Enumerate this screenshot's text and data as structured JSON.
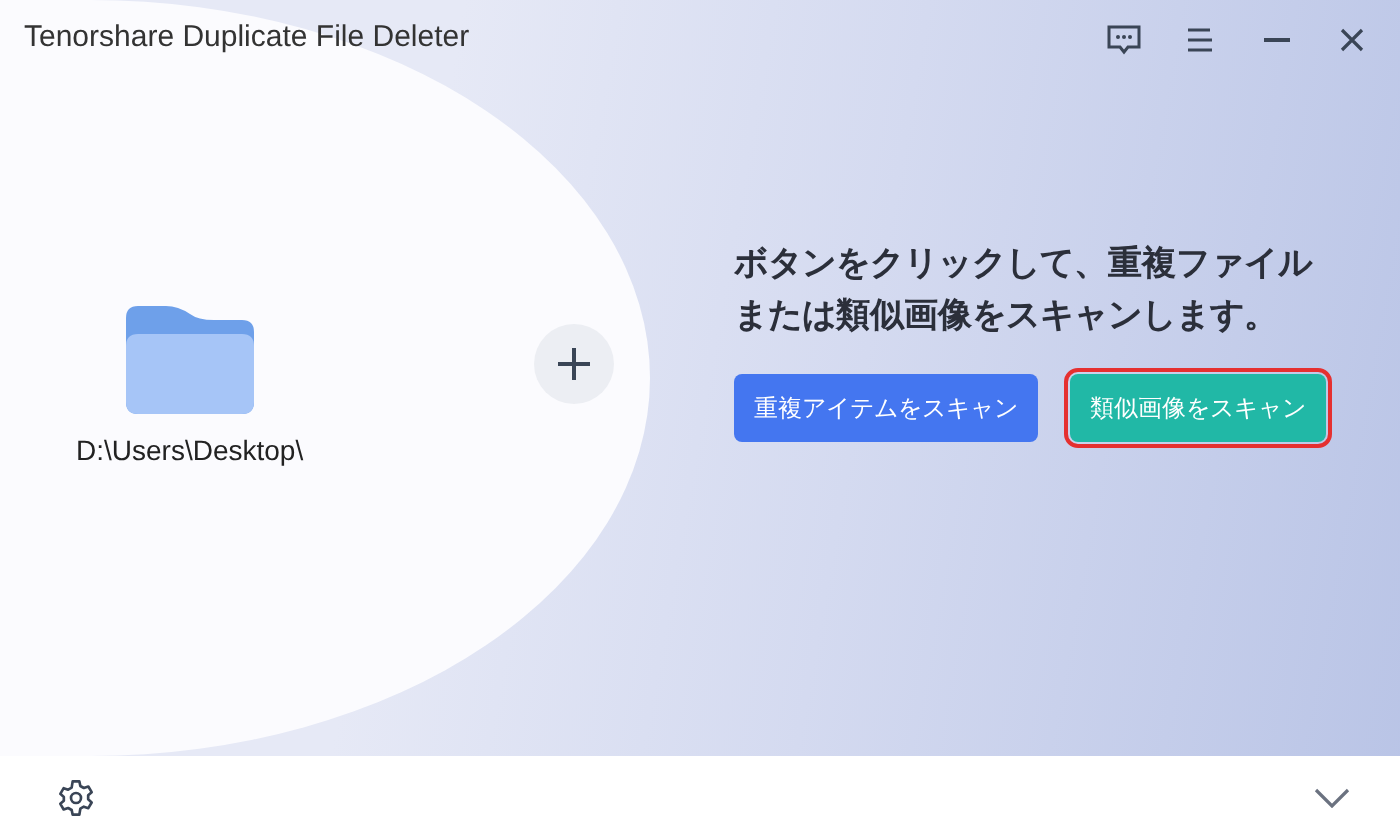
{
  "window": {
    "title": "Tenorshare Duplicate File Deleter"
  },
  "folder": {
    "path": "D:\\Users\\Desktop\\"
  },
  "prompt": "ボタンをクリックして、重複ファイルまたは類似画像をスキャンします。",
  "buttons": [
    {
      "label": "重複アイテムをスキャン",
      "kind": "primary",
      "highlighted": false
    },
    {
      "label": "類似画像をスキャン",
      "kind": "secondary",
      "highlighted": true
    }
  ]
}
